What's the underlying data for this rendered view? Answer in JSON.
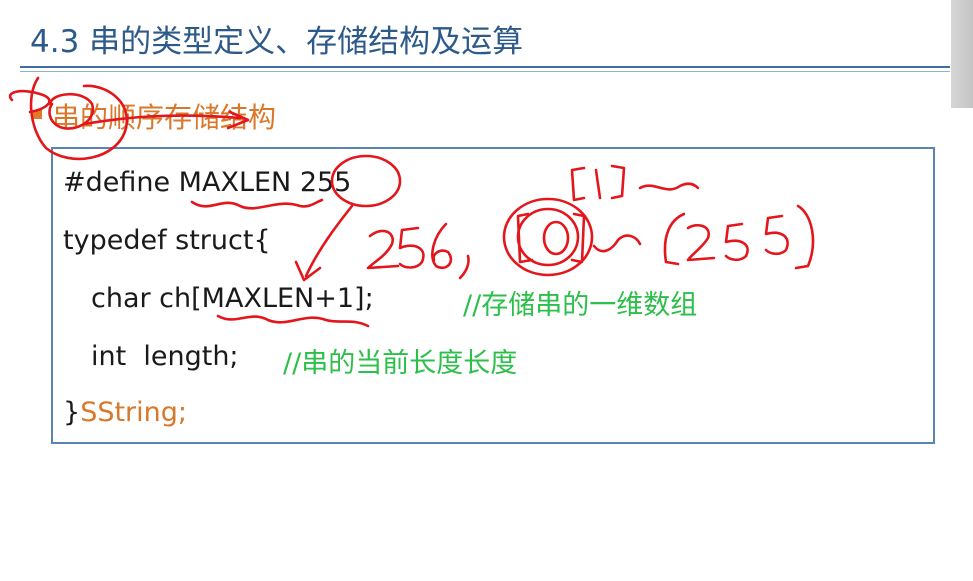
{
  "slide": {
    "title": "4.3 串的类型定义、存储结构及运算",
    "subheading": "串的顺序存储结构"
  },
  "code": {
    "line1": "#define MAXLEN 255",
    "line2": "typedef struct{",
    "line3_code": "char ch[MAXLEN+1];",
    "line3_comment": "//存储串的一维数组",
    "line4_code": "int  length;",
    "line4_comment": "//串的当前长度长度",
    "line5_brace": "}",
    "line5_type": "SString;"
  },
  "colors": {
    "title": "#2d5a8a",
    "accent": "#d9782a",
    "comment": "#2cbf4a",
    "border": "#5a84b4",
    "ink": "#e3161b"
  }
}
